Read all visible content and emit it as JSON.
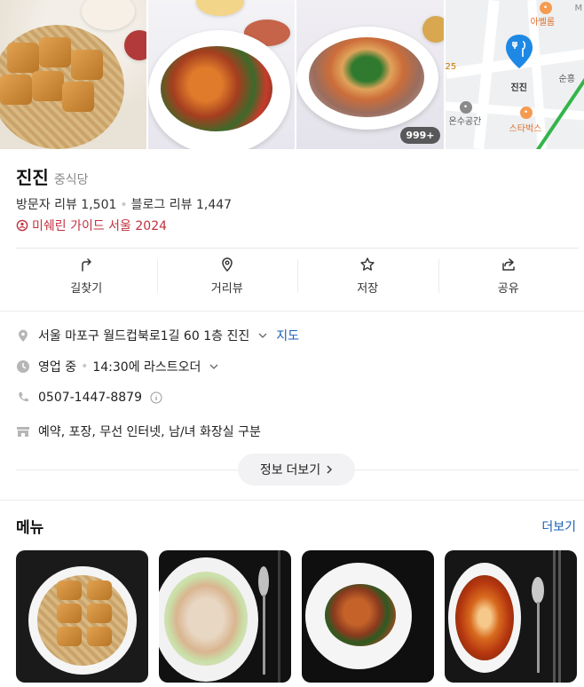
{
  "photos": {
    "count_badge": "999+"
  },
  "map": {
    "labels": {
      "poi_top": "아벨롬",
      "poi_top_letter": "M",
      "pin_label": "진진",
      "poi_right": "순흥",
      "poi_left": "온수공간",
      "poi_bottom": "스타벅스",
      "road_num": "25"
    }
  },
  "place": {
    "name": "진진",
    "category": "중식당",
    "visitor_review": "방문자 리뷰 1,501",
    "blog_review": "블로그 리뷰 1,447",
    "michelin": "미쉐린 가이드 서울 2024"
  },
  "actions": [
    {
      "label": "길찾기",
      "icon": "directions-icon"
    },
    {
      "label": "거리뷰",
      "icon": "location-pin-icon"
    },
    {
      "label": "저장",
      "icon": "star-icon"
    },
    {
      "label": "공유",
      "icon": "share-icon"
    }
  ],
  "details": {
    "address": "서울 마포구 월드컵북로1길 60 1층 진진",
    "map_link": "지도",
    "hours_status": "영업 중",
    "hours_detail": "14:30에 라스트오더",
    "phone": "0507-1447-8879",
    "amenities": "예약, 포장, 무선 인터넷, 남/녀 화장실 구분",
    "more_button": "정보 더보기"
  },
  "menu": {
    "title": "메뉴",
    "more": "더보기"
  },
  "colors": {
    "link": "#1a5fb4",
    "michelin": "#c2303e",
    "pin": "#1e88e5",
    "poi": "#f59b50"
  }
}
